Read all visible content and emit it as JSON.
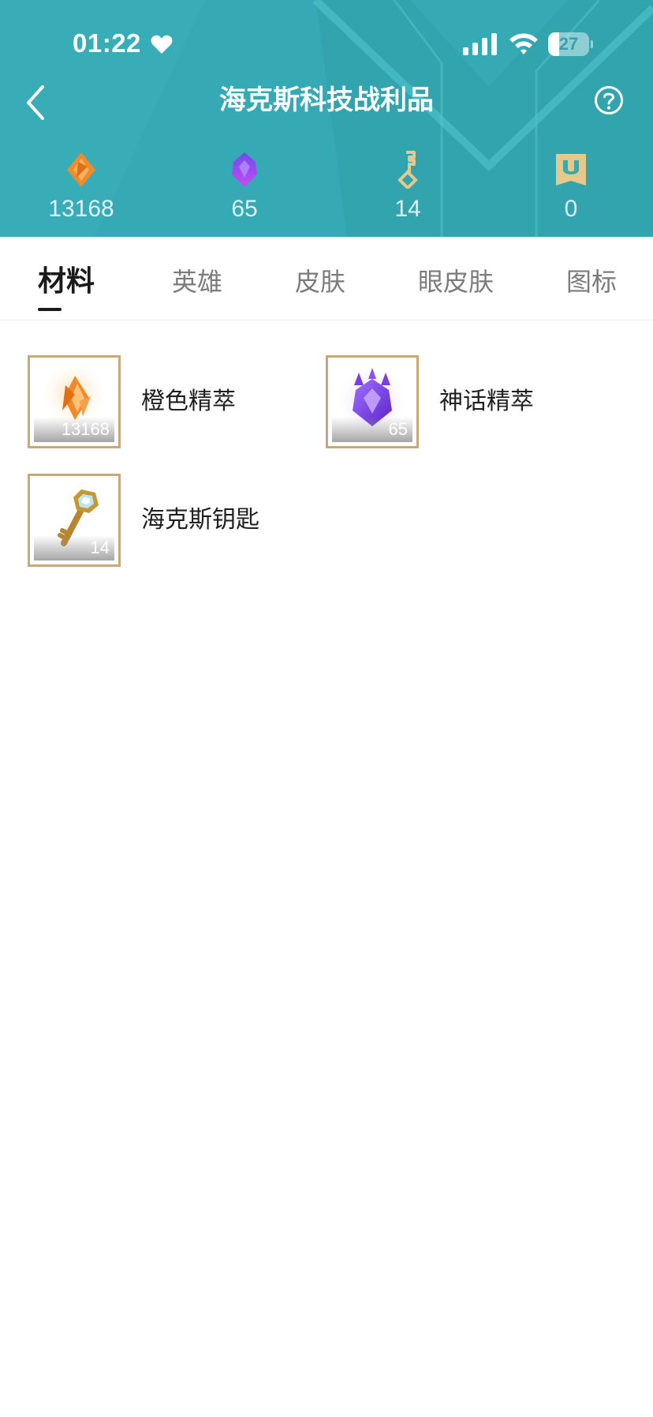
{
  "status_bar": {
    "time": "01:22",
    "battery_level": "27",
    "battery_fraction": 0.27
  },
  "header": {
    "title": "海克斯科技战利品",
    "background_color": "#36aab4",
    "icons": {
      "back": "chevron-left-icon",
      "help": "question-circle-icon"
    }
  },
  "currencies": [
    {
      "icon": "orange-essence-icon",
      "value": "13168",
      "color": "#f08a2c"
    },
    {
      "icon": "mythic-essence-icon",
      "value": "65",
      "color": "#8a4cf0"
    },
    {
      "icon": "hextech-key-icon",
      "value": "14",
      "color": "#e6c98a"
    },
    {
      "icon": "ancient-shard-icon",
      "value": "0",
      "color": "#e6c98a"
    }
  ],
  "tabs": [
    {
      "label": "材料",
      "active": true
    },
    {
      "label": "英雄",
      "active": false
    },
    {
      "label": "皮肤",
      "active": false
    },
    {
      "label": "眼皮肤",
      "active": false
    },
    {
      "label": "图标",
      "active": false
    }
  ],
  "items": [
    {
      "name": "橙色精萃",
      "count": "13168",
      "icon": "orange-essence-icon"
    },
    {
      "name": "神话精萃",
      "count": "65",
      "icon": "mythic-essence-icon"
    },
    {
      "name": "海克斯钥匙",
      "count": "14",
      "icon": "hextech-key-icon"
    }
  ],
  "colors": {
    "frame_gold": "#c8a975",
    "active_tab": "#1a1a1a",
    "inactive_tab": "#7b7b7b"
  }
}
